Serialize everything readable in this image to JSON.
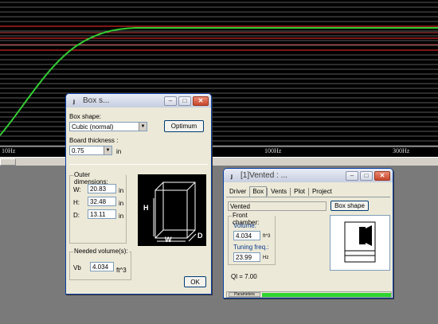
{
  "plot": {
    "x_ticks": [
      "10Hz",
      "100Hz",
      "300Hz"
    ],
    "colors": {
      "background": "#000000",
      "curve": "#33cc33",
      "grid_major": "#ff3030",
      "grid_minor": "#5a5a5a"
    }
  },
  "box_window": {
    "title": "Box s...",
    "shape_label": "Box shape:",
    "shape_value": "Cubic (normal)",
    "optimum_label": "Optimum",
    "board_label": "Board thickness :",
    "board_value": "0.75",
    "board_unit": "in",
    "outer_title": "Outer dimensions:",
    "dims": [
      {
        "label": "W:",
        "value": "20.83",
        "unit": "in"
      },
      {
        "label": "H:",
        "value": "32.48",
        "unit": "in"
      },
      {
        "label": "D:",
        "value": "13.11",
        "unit": "in"
      }
    ],
    "diagram": {
      "h": "H",
      "w": "W",
      "d": "D"
    },
    "needed_title": "Needed volume(s):",
    "vb_label": "Vb",
    "vb_value": "4.034",
    "vb_unit": "ft^3",
    "ok_label": "OK"
  },
  "vented_window": {
    "title": "[1]Vented : ...",
    "tabs": [
      "Driver",
      "Box",
      "Vents",
      "Plot",
      "Project"
    ],
    "active_tab": "Box",
    "type_value": "Vented",
    "box_shape_button": "Box shape",
    "front_title": "Front chamber:",
    "volume_label": "Volume:",
    "volume_value": "4.034",
    "volume_unit": "ft^3",
    "tuning_label": "Tuning freq.:",
    "tuning_value": "23.99",
    "tuning_unit": "Hz",
    "ql_text": "Ql = 7.00",
    "status_text": "Parameters"
  }
}
